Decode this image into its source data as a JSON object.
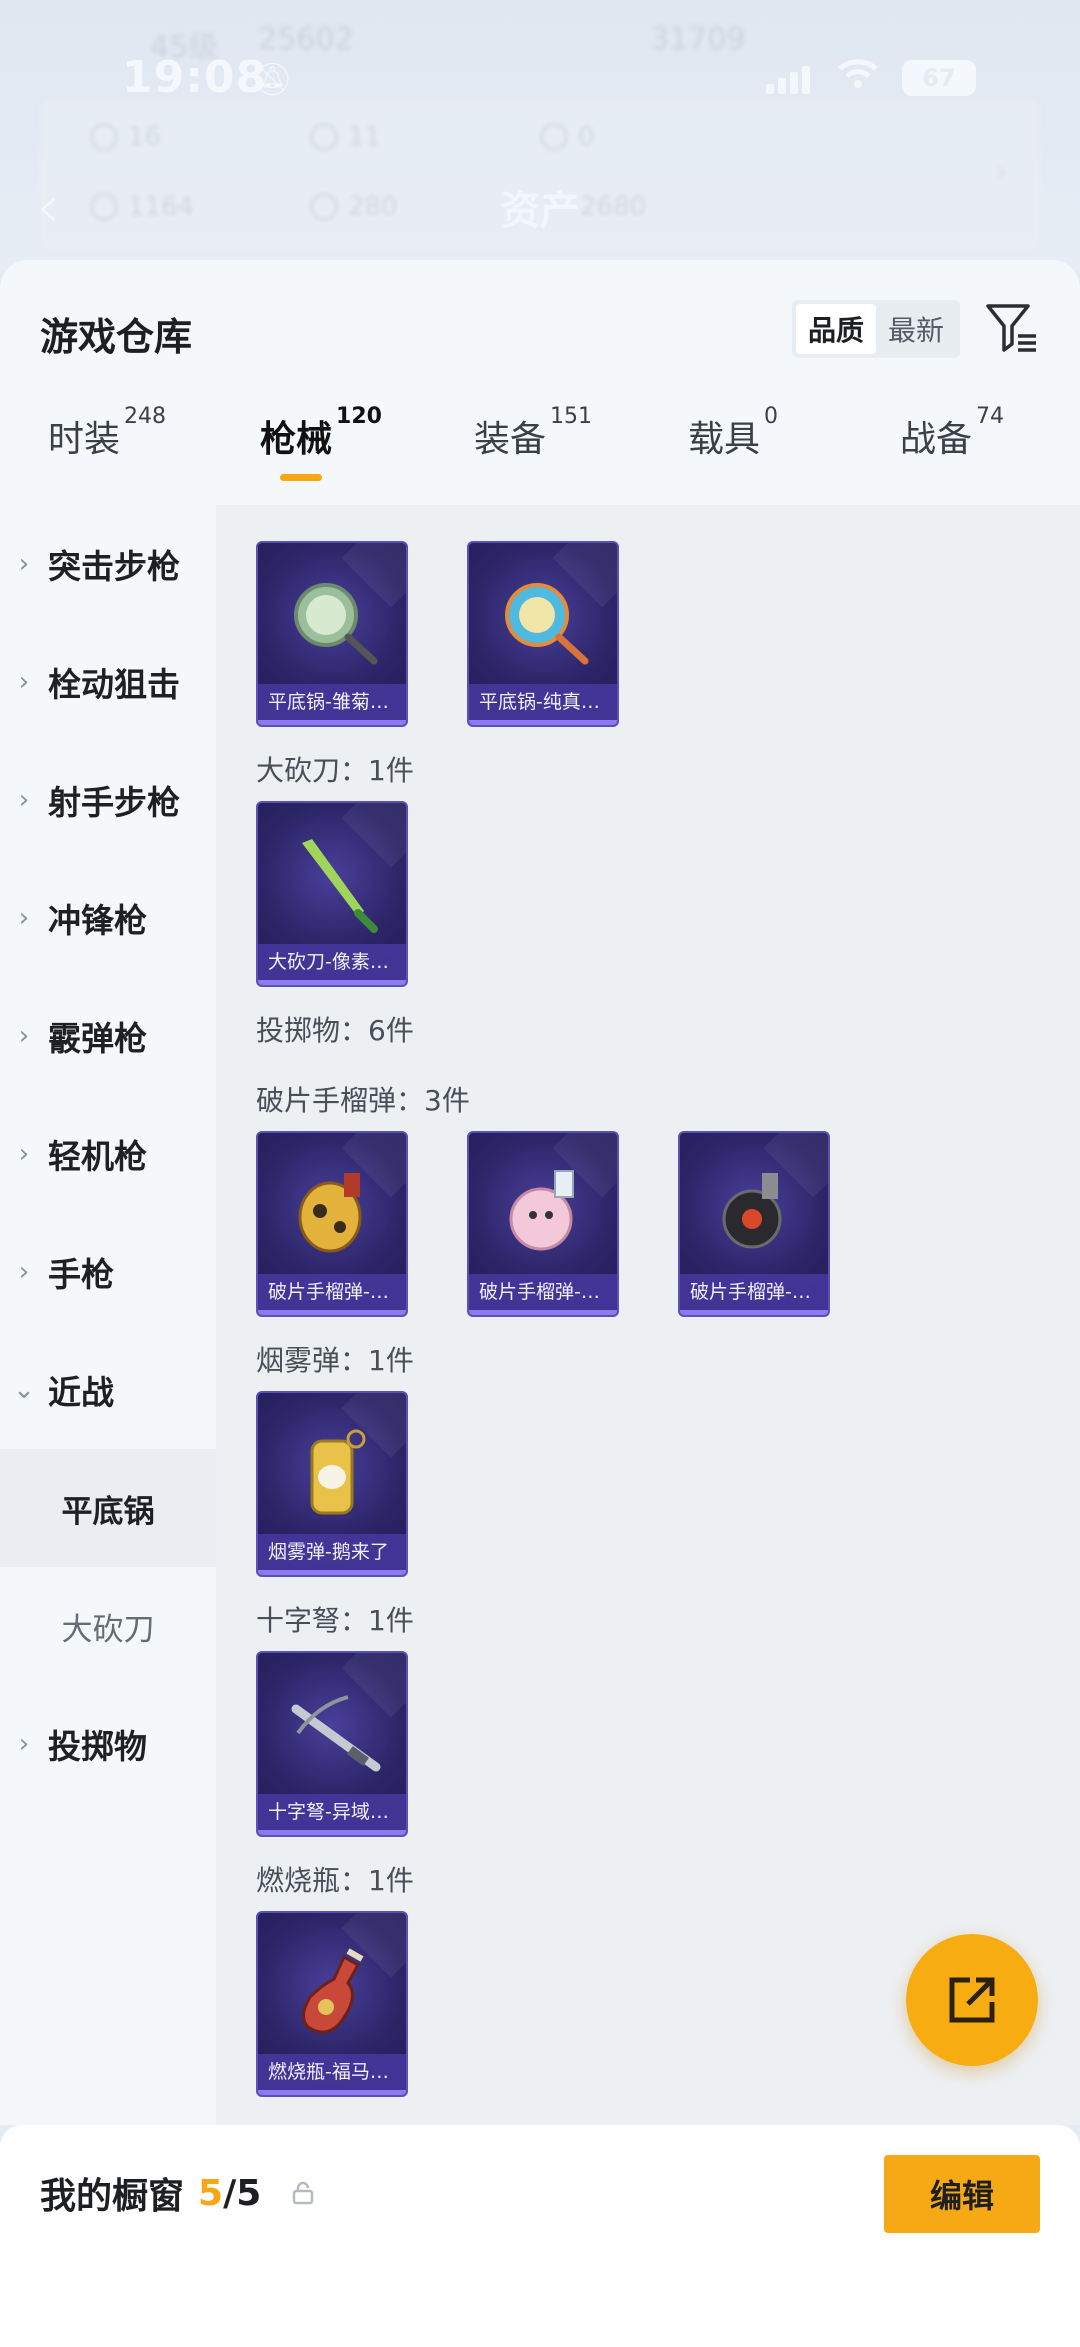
{
  "status_bar": {
    "time": "19:08",
    "battery": "67"
  },
  "bg_header": {
    "level": "45级",
    "coins": "25602",
    "score": "31709",
    "stats": [
      "16",
      "11",
      "0",
      "1164",
      "280"
    ],
    "title": "资产",
    "title_value": "2680"
  },
  "panel": {
    "title": "游戏仓库",
    "sort": {
      "quality": "品质",
      "latest": "最新",
      "selected": "品质"
    }
  },
  "tabs": [
    {
      "label": "时装",
      "count": "248"
    },
    {
      "label": "枪械",
      "count": "120",
      "active": true
    },
    {
      "label": "装备",
      "count": "151"
    },
    {
      "label": "载具",
      "count": "0"
    },
    {
      "label": "战备",
      "count": "74"
    }
  ],
  "sidebar": {
    "categories": [
      "突击步枪",
      "栓动狙击",
      "射手步枪",
      "冲锋枪",
      "霰弹枪",
      "轻机枪",
      "手枪",
      "近战"
    ],
    "expanded_subs": [
      "平底锅",
      "大砍刀"
    ],
    "active_sub": "平底锅",
    "last_category": "投掷物"
  },
  "content": {
    "pans": [
      "平底锅-雏菊…",
      "平底锅-纯真…"
    ],
    "machete_label": "大砍刀：1件",
    "machete": [
      "大砍刀-像素…"
    ],
    "throwables_label": "投掷物：6件",
    "frag_label": "破片手榴弹：3件",
    "frags": [
      "破片手榴弹-…",
      "破片手榴弹-…",
      "破片手榴弹-…"
    ],
    "smoke_label": "烟雾弹：1件",
    "smoke": [
      "烟雾弹-鹅来了"
    ],
    "crossbow_label": "十字弩：1件",
    "crossbow": [
      "十字弩-异域…"
    ],
    "molotov_label": "燃烧瓶：1件",
    "molotov": [
      "燃烧瓶-福马…"
    ]
  },
  "bottom": {
    "showcase_label": "我的橱窗",
    "showcase_count": "5",
    "showcase_total": "/5",
    "edit_label": "编辑"
  },
  "colors": {
    "accent": "#f5a714",
    "card_bg": "#2b2466",
    "card_label": "#4638a0"
  }
}
